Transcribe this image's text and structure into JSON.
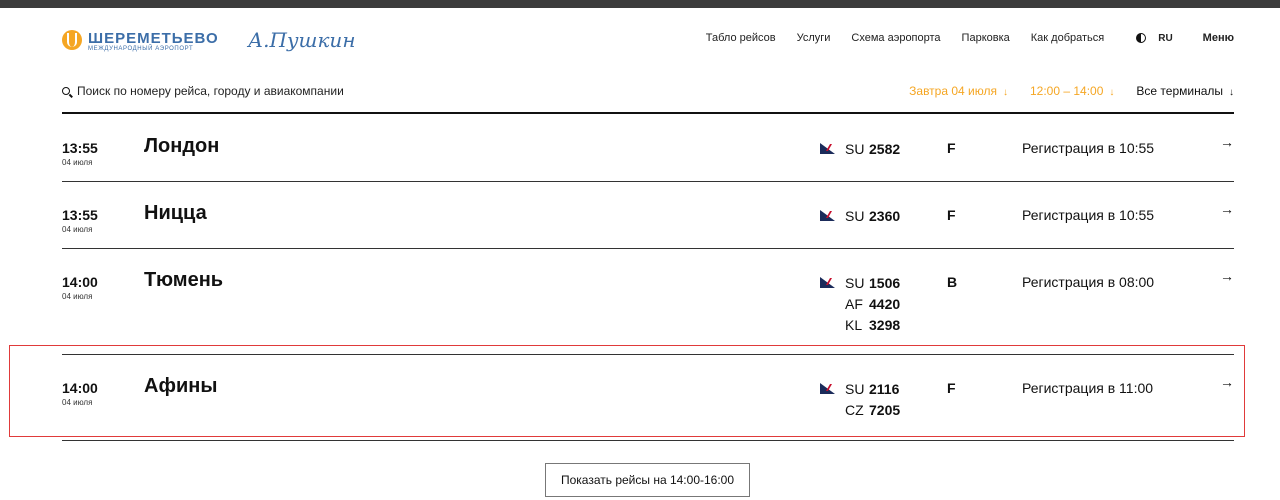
{
  "brand": {
    "logo_name": "ШЕРЕМЕТЬЕВО",
    "logo_subtitle": "МЕЖДУНАРОДНЫЙ АЭРОПОРТ",
    "signature": "А.Пушкин"
  },
  "nav": {
    "items": [
      "Табло рейсов",
      "Услуги",
      "Схема аэропорта",
      "Парковка",
      "Как добраться"
    ],
    "lang": "RU",
    "menu": "Меню"
  },
  "search": {
    "placeholder": "Поиск по номеру рейса, городу и авиакомпании"
  },
  "filters": {
    "date": "Завтра 04 июля",
    "time": "12:00 – 14:00",
    "terminal": "Все терминалы",
    "arrow": "↓"
  },
  "colors": {
    "accent": "#f5a623",
    "brand": "#3c6ea8",
    "highlight": "#e03a3a"
  },
  "flights": [
    {
      "time": "13:55",
      "date": "04 июля",
      "city": "Лондон",
      "codes": [
        {
          "airline": "SU",
          "number": "2582"
        }
      ],
      "terminal": "F",
      "status": "Регистрация в 10:55",
      "arrow": "→"
    },
    {
      "time": "13:55",
      "date": "04 июля",
      "city": "Ницца",
      "codes": [
        {
          "airline": "SU",
          "number": "2360"
        }
      ],
      "terminal": "F",
      "status": "Регистрация в 10:55",
      "arrow": "→"
    },
    {
      "time": "14:00",
      "date": "04 июля",
      "city": "Тюмень",
      "codes": [
        {
          "airline": "SU",
          "number": "1506"
        },
        {
          "airline": "AF",
          "number": "4420"
        },
        {
          "airline": "KL",
          "number": "3298"
        }
      ],
      "terminal": "B",
      "status": "Регистрация в 08:00",
      "arrow": "→"
    },
    {
      "time": "14:00",
      "date": "04 июля",
      "city": "Афины",
      "codes": [
        {
          "airline": "SU",
          "number": "2116"
        },
        {
          "airline": "CZ",
          "number": "7205"
        }
      ],
      "terminal": "F",
      "status": "Регистрация в 11:00",
      "arrow": "→"
    }
  ],
  "show_more": "Показать рейсы на 14:00-16:00"
}
